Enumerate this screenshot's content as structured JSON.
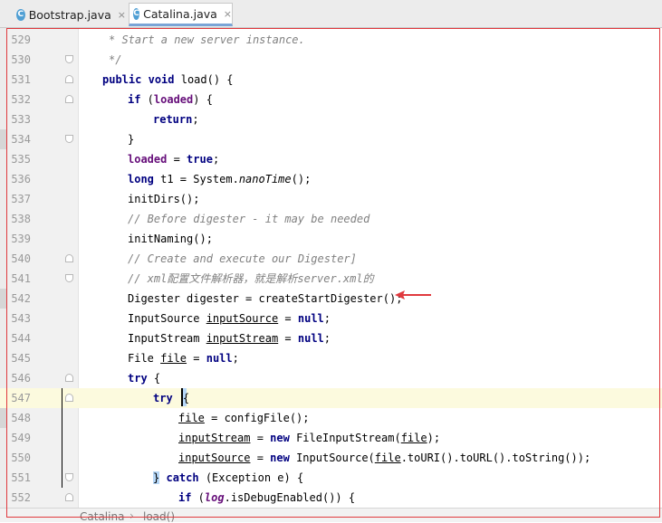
{
  "tabs": [
    {
      "label": "Bootstrap.java",
      "icon": "class-icon",
      "icon_letter": "C",
      "active": false
    },
    {
      "label": "Catalina.java",
      "icon": "class-icon",
      "icon_letter": "C",
      "active": true
    }
  ],
  "close_glyph": "×",
  "lines": [
    {
      "num": "529"
    },
    {
      "num": "530"
    },
    {
      "num": "531"
    },
    {
      "num": "532"
    },
    {
      "num": "533"
    },
    {
      "num": "534"
    },
    {
      "num": "535"
    },
    {
      "num": "536"
    },
    {
      "num": "537"
    },
    {
      "num": "538"
    },
    {
      "num": "539"
    },
    {
      "num": "540"
    },
    {
      "num": "541"
    },
    {
      "num": "542"
    },
    {
      "num": "543"
    },
    {
      "num": "544"
    },
    {
      "num": "545"
    },
    {
      "num": "546"
    },
    {
      "num": "547"
    },
    {
      "num": "548"
    },
    {
      "num": "549"
    },
    {
      "num": "550"
    },
    {
      "num": "551"
    },
    {
      "num": "552"
    }
  ],
  "code": {
    "l529": "* Start a new server instance.",
    "l530": "*/",
    "l531_kw1": "public",
    "l531_kw2": "void",
    "l531_rest": " load() {",
    "l532_kw": "if",
    "l532_fld": "loaded",
    "l533_kw": "return",
    "l534": "}",
    "l535_fld": "loaded",
    "l535_kw": "true",
    "l536_kw": "long",
    "l536_mid": " t1 = System.",
    "l536_call": "nanoTime",
    "l537": "initDirs();",
    "l538": "// Before digester - it may be needed",
    "l539": "initNaming();",
    "l540": "// Create and execute our Digester]",
    "l541": "// xml配置文件解析器，就是解析server.xml的",
    "l542": "Digester digester = createStartDigester();",
    "l543_type": "InputSource ",
    "l543_var": "inputSource",
    "l543_kw": "null",
    "l544_type": "InputStream ",
    "l544_var": "inputStream",
    "l544_kw": "null",
    "l545_type": "File ",
    "l545_var": "file",
    "l545_kw": "null",
    "l546_kw": "try",
    "l547_kw": "try",
    "l548_var": "file",
    "l548_rest": " = configFile();",
    "l549_var": "inputStream",
    "l549_kw": "new",
    "l549_mid": " FileInputStream(",
    "l549_arg": "file",
    "l550_var": "inputSource",
    "l550_kw": "new",
    "l550_mid": " InputSource(",
    "l550_arg": "file",
    "l550_rest": ".toURI().toURL().toString());",
    "l551_kw": "catch",
    "l551_rest": " (Exception e) {",
    "l552_kw": "if",
    "l552_log": "log",
    "l552_rest": ".isDebugEnabled()) {"
  },
  "breadcrumb": {
    "class": "Catalina",
    "method": "load()",
    "separator": "›"
  },
  "colors": {
    "keyword": "#000080",
    "comment": "#808080",
    "field": "#660e7a",
    "current_line": "#fcfade",
    "annotation_border": "#e0393e"
  }
}
